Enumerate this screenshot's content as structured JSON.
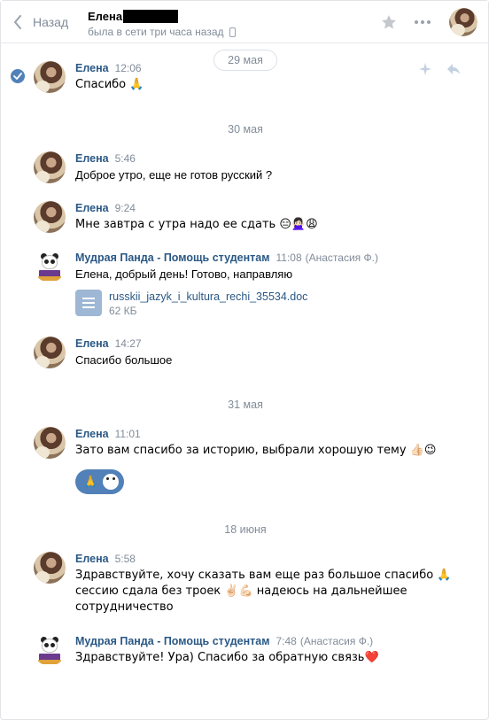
{
  "header": {
    "back_label": "Назад",
    "peer_name": "Елена",
    "peer_status": "была в сети три часа назад"
  },
  "dates": {
    "d1": "29 мая",
    "d2": "30 мая",
    "d3": "31 мая",
    "d4": "18 июня"
  },
  "messages": [
    {
      "author": "Елена",
      "time": "12:06",
      "text": "Спасибо 🙏"
    },
    {
      "author": "Елена",
      "time": "5:46",
      "text": "Доброе утро, еще не готов русский ?"
    },
    {
      "author": "Елена",
      "time": "9:24",
      "text": "Мне завтра с утра надо ее сдать 😑🙅🏻‍♀️😩"
    },
    {
      "author": "Мудрая Панда - Помощь студентам",
      "time": "11:08",
      "sub_author": "(Анастасия Ф.)",
      "text": "Елена, добрый день! Готово, направляю",
      "doc": {
        "name": "russkii_jazyk_i_kultura_rechi_35534.doc",
        "size": "62 КБ"
      }
    },
    {
      "author": "Елена",
      "time": "14:27",
      "text": "Спасибо большое"
    },
    {
      "author": "Елена",
      "time": "11:01",
      "text": "Зато вам спасибо за историю, выбрали хорошую тему 👍🏻😉",
      "reaction_emoji": "🙏"
    },
    {
      "author": "Елена",
      "time": "5:58",
      "text_lines": [
        "Здравствуйте, хочу сказать вам еще раз большое спасибо 🙏",
        "сессию сдала без троек ✌🏻💪🏻 надеюсь на дальнейшее",
        "сотрудничество"
      ]
    },
    {
      "author": "Мудрая Панда - Помощь студентам",
      "time": "7:48",
      "sub_author": "(Анастасия Ф.)",
      "text": "Здравствуйте! Ура) Спасибо за обратную связь❤️"
    }
  ],
  "colors": {
    "accent": "#5181b8",
    "author_link": "#2a5885",
    "muted": "#818c99"
  }
}
